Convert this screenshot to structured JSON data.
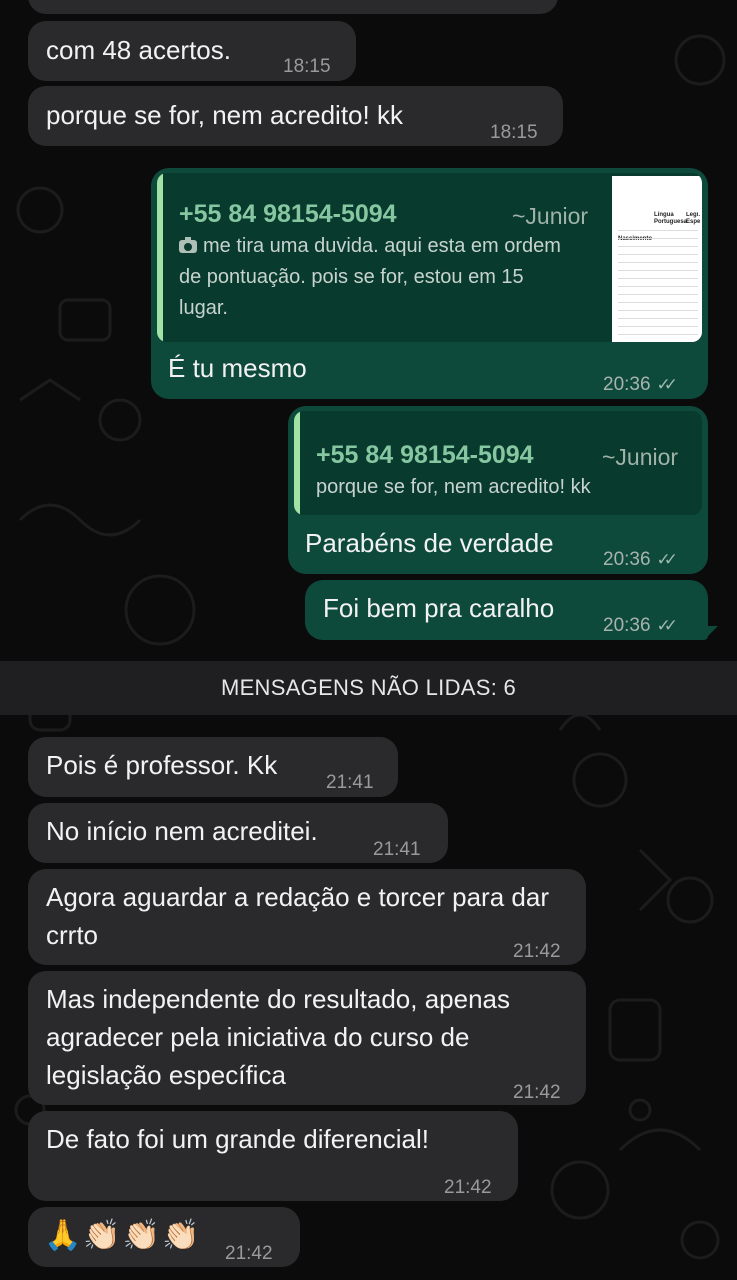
{
  "messages_before": [
    {
      "text": "com 48 acertos.",
      "time": "18:15"
    },
    {
      "text": "porque se for, nem acredito! kk",
      "time": "18:15"
    }
  ],
  "reply1": {
    "quoted_phone": "+55 84 98154-5094",
    "quoted_name": "~Junior",
    "quoted_icon": "camera-icon",
    "quoted_text": "me tira uma duvida. aqui esta em ordem de pontuação. pois se for, estou em 15 lugar.",
    "thumbnail_headers": [
      "Nascimento",
      "Língua Portuguesa",
      "Legi. Espe"
    ],
    "text": "É tu mesmo",
    "time": "20:36"
  },
  "reply2": {
    "quoted_phone": "+55 84 98154-5094",
    "quoted_name": "~Junior",
    "quoted_text": "porque se for, nem acredito! kk",
    "text": "Parabéns de verdade",
    "time": "20:36"
  },
  "out3": {
    "text": "Foi bem pra caralho",
    "time": "20:36"
  },
  "unread_label": "MENSAGENS NÃO LIDAS: 6",
  "messages_after": [
    {
      "text": "Pois é professor. Kk",
      "time": "21:41"
    },
    {
      "text": "No início nem acreditei.",
      "time": "21:41"
    },
    {
      "text": "Agora aguardar a redação e torcer para dar crrto",
      "time": "21:42"
    },
    {
      "text": "Mas independente do resultado, apenas agradecer pela iniciativa do curso de legislação específica",
      "time": "21:42"
    },
    {
      "text": "De fato foi um grande diferencial!",
      "time": "21:42"
    },
    {
      "text": "🙏👏🏻👏🏻👏🏻",
      "time": "21:42"
    }
  ],
  "colors": {
    "incoming": "#2a2a2c",
    "outgoing": "#0d4a3b",
    "quote_bar": "#a2e3a5"
  }
}
